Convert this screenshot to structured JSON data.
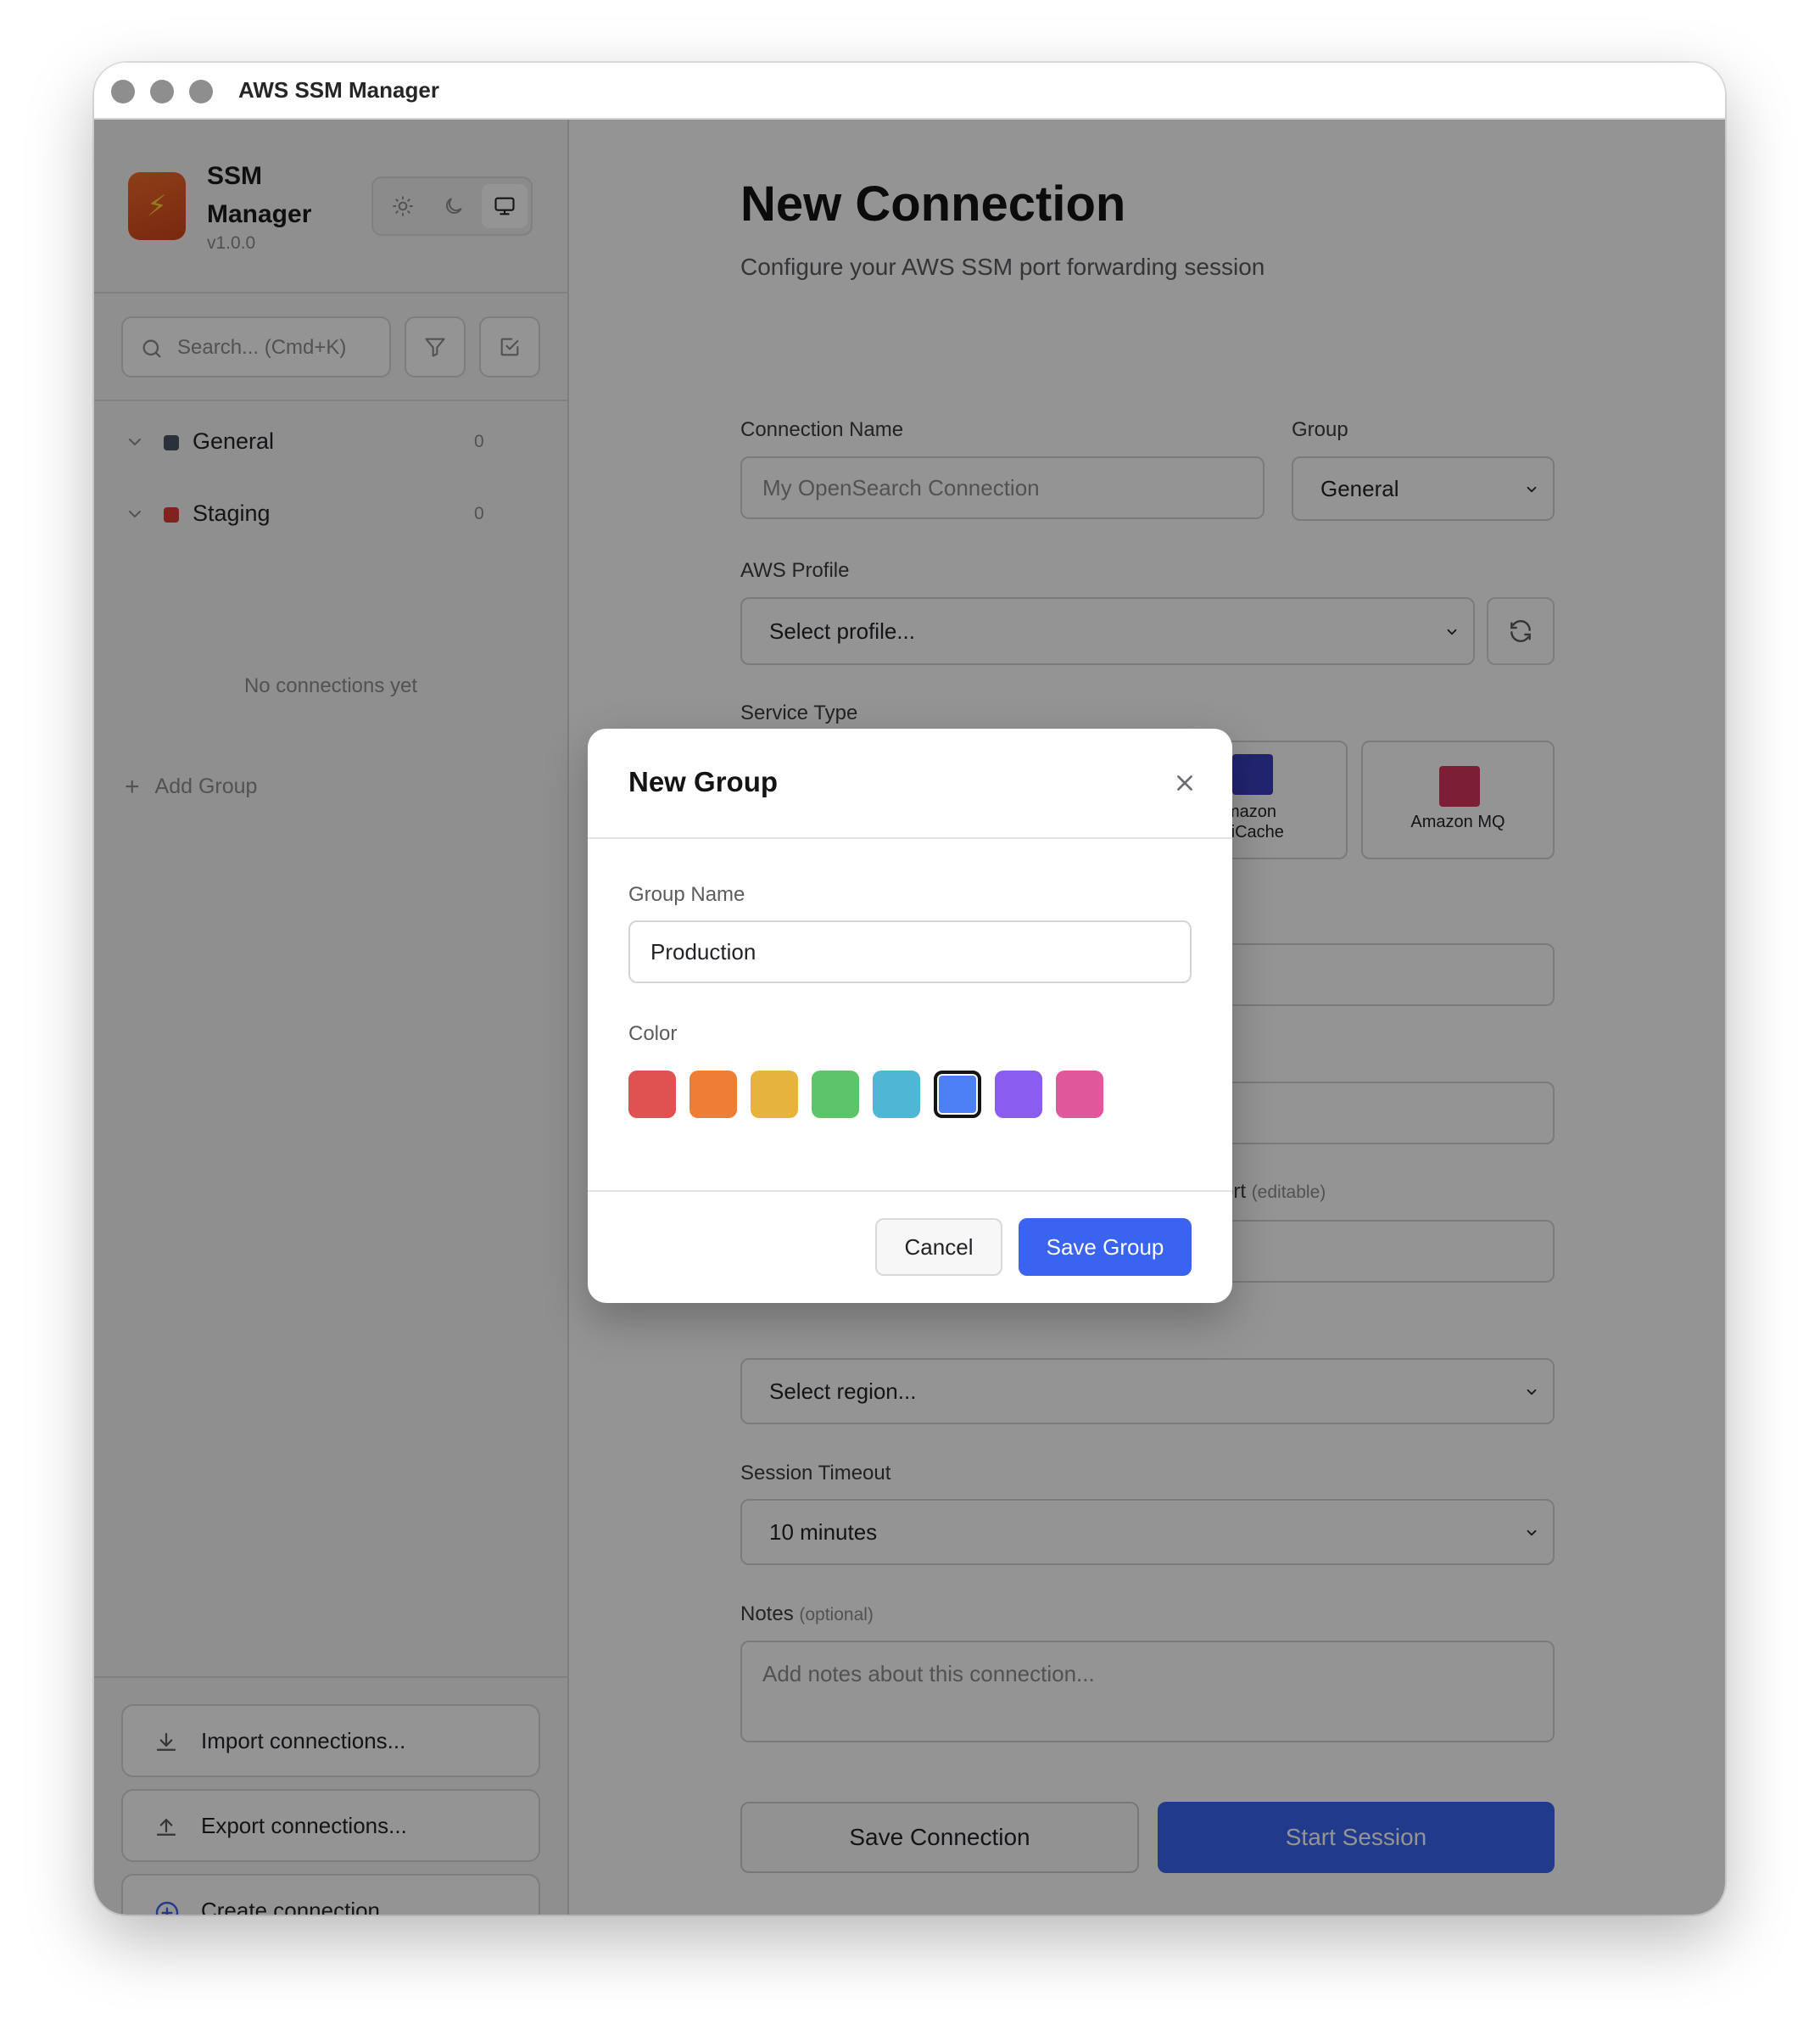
{
  "window": {
    "title": "AWS SSM Manager"
  },
  "sidebar": {
    "brand": {
      "name": "SSM Manager",
      "version": "v1.0.0"
    },
    "theme_icons": [
      "sun-icon",
      "moon-icon",
      "monitor-icon"
    ],
    "search": {
      "placeholder": "Search... (Cmd+K)"
    },
    "groups": [
      {
        "name": "General",
        "count": "0",
        "color": "#4b5563"
      },
      {
        "name": "Staging",
        "count": "0",
        "color": "#dc3b34"
      }
    ],
    "empty_message": "No connections yet",
    "add_group_label": "Add Group",
    "bottom_buttons": [
      {
        "label": "Import connections...",
        "icon": "download-icon"
      },
      {
        "label": "Export connections...",
        "icon": "upload-icon"
      },
      {
        "label": "Create connection...",
        "icon": "plus-circle-icon"
      }
    ]
  },
  "main": {
    "title": "New Connection",
    "subtitle": "Configure your AWS SSM port forwarding session",
    "connection_name": {
      "label": "Connection Name",
      "placeholder": "My OpenSearch Connection"
    },
    "group": {
      "label": "Group",
      "value": "General"
    },
    "aws_profile": {
      "label": "AWS Profile",
      "value": "Select profile..."
    },
    "service_type": {
      "label": "Service Type",
      "services": [
        {
          "name": "",
          "icon": "opensearch-icon",
          "color": "#5b3fc4"
        },
        {
          "name": "",
          "icon": "rds-icon",
          "color": "#3b49c8"
        },
        {
          "name": "mazon\nstiCache",
          "icon": "elasticache-icon",
          "color": "#3b3fc2"
        },
        {
          "name": "Amazon MQ",
          "icon": "amazon-mq-icon",
          "color": "#d5345e"
        }
      ]
    },
    "local_port_label_fragment": "ort",
    "local_port_label_suffix": "(editable)",
    "region": {
      "value": "Select region..."
    },
    "session_timeout": {
      "label": "Session Timeout",
      "value": "10 minutes"
    },
    "notes": {
      "label": "Notes",
      "label_suffix": "(optional)",
      "placeholder": "Add notes about this connection..."
    },
    "buttons": {
      "save": "Save Connection",
      "start": "Start Session"
    }
  },
  "modal": {
    "title": "New Group",
    "group_name_label": "Group Name",
    "group_name_value": "Production",
    "color_label": "Color",
    "colors": [
      "#e05252",
      "#ee7d35",
      "#e6b33c",
      "#5ec46a",
      "#4fb6d3",
      "#4d7ff5",
      "#8b5cf0",
      "#e0579c"
    ],
    "selected_color": "#4d7ff5",
    "cancel_label": "Cancel",
    "save_label": "Save Group"
  }
}
